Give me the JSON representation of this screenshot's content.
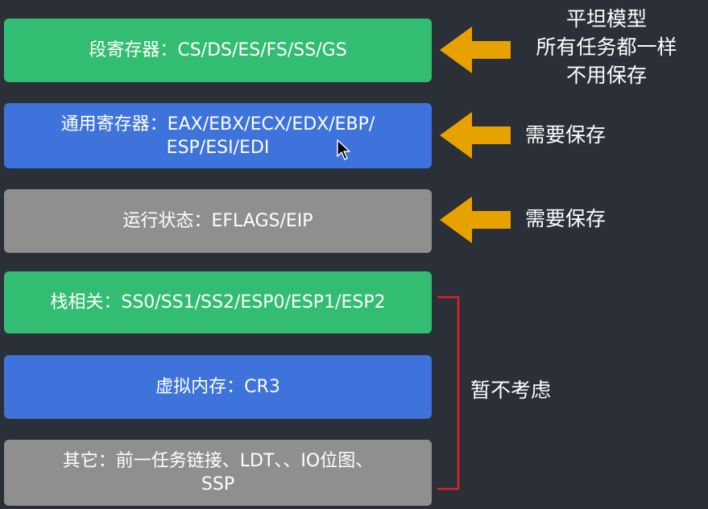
{
  "boxes": {
    "segment": {
      "text": "段寄存器：CS/DS/ES/FS/SS/GS",
      "color": "#33bd72"
    },
    "general": {
      "line1": "通用寄存器：EAX/EBX/ECX/EDX/EBP/",
      "line2": "ESP/ESI/EDI",
      "color": "#3e73dc"
    },
    "run": {
      "text": "运行状态：EFLAGS/EIP",
      "color": "#8f8f8f"
    },
    "stack": {
      "text": "栈相关：SS0/SS1/SS2/ESP0/ESP1/ESP2",
      "color": "#33bd72"
    },
    "vmem": {
      "text": "虚拟内存：CR3",
      "color": "#3e73dc"
    },
    "other": {
      "line1": "其它：前一任务链接、LDT、、IO位图、",
      "line2": "SSP",
      "color": "#8f8f8f"
    }
  },
  "notes": {
    "flat": {
      "line1": "平坦模型",
      "line2": "所有任务都一样",
      "line3": "不用保存"
    },
    "save1": "需要保存",
    "save2": "需要保存",
    "ignore": "暂不考虑"
  },
  "colors": {
    "background": "#2b2f38",
    "arrow": "#e8a200",
    "bracket": "#e0202a"
  }
}
